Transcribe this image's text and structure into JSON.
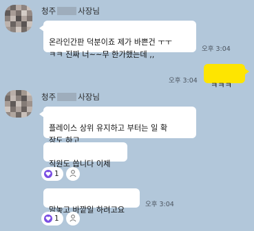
{
  "colors": {
    "background": "#b2c7da",
    "bubble_in": "#ffffff",
    "bubble_out": "#fee500",
    "reaction_accent": "#7b4fe3"
  },
  "messages": [
    {
      "sender": {
        "prefix": "청주",
        "suffix": "사장님"
      },
      "text": "온라인간판 덕분이죠 제가 바쁜건 ㅜㅜ\nㅋㅋ 진짜 너~~무 한가했는데 ,,",
      "time": "오후 3:04"
    },
    {
      "mine": true,
      "text": "ㅋㅋㅋ",
      "time": "오후 3:04"
    },
    {
      "sender": {
        "prefix": "청주",
        "suffix": "사장님"
      },
      "texts": [
        "플레이스 상위 유지하고 부터는 일 확\n장도 하고",
        "직원도 씁니다 이제",
        "맘놓고 바깥일 하려고요"
      ],
      "reaction_count_1": "1",
      "time": "오후 3:04",
      "reaction_count_2": "1"
    }
  ],
  "icons": {
    "reaction": "heart-reaction-icon",
    "add_reaction": "person-add-reaction-icon"
  }
}
